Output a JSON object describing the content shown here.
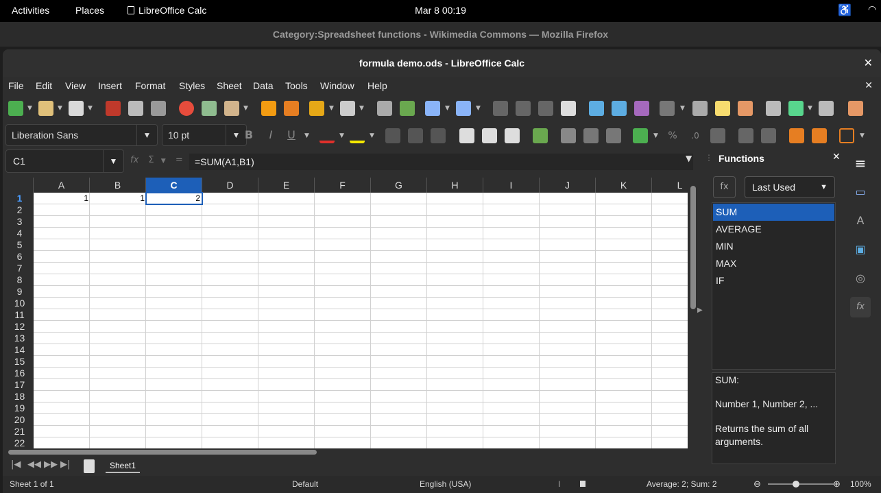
{
  "topbar": {
    "activities": "Activities",
    "places": "Places",
    "app_name": "LibreOffice Calc",
    "clock": "Mar 8  00:19"
  },
  "background_window": {
    "title": "Category:Spreadsheet functions - Wikimedia Commons — Mozilla Firefox"
  },
  "window": {
    "title": "formula demo.ods - LibreOffice Calc",
    "close": "✕"
  },
  "menu": {
    "items": [
      "File",
      "Edit",
      "View",
      "Insert",
      "Format",
      "Styles",
      "Sheet",
      "Data",
      "Tools",
      "Window",
      "Help"
    ],
    "doc_close": "✕"
  },
  "format_bar": {
    "font_name": "Liberation Sans",
    "font_size": "10 pt"
  },
  "formula_bar": {
    "name_box": "C1",
    "fx": "fx",
    "sigma": "Σ",
    "equals": "=",
    "formula": "=SUM(A1,B1)"
  },
  "grid": {
    "columns": [
      "A",
      "B",
      "C",
      "D",
      "E",
      "F",
      "G",
      "H",
      "I",
      "J",
      "K",
      "L"
    ],
    "selected_column": "C",
    "rows": [
      "1",
      "2",
      "3",
      "4",
      "5",
      "6",
      "7",
      "8",
      "9",
      "10",
      "11",
      "12",
      "13",
      "14",
      "15",
      "16",
      "17",
      "18",
      "19",
      "20",
      "21",
      "22"
    ],
    "cells": {
      "A1": "1",
      "B1": "1",
      "C1": "2"
    }
  },
  "sheet_tabs": {
    "tabs": [
      "Sheet1"
    ]
  },
  "status": {
    "sheet_pos": "Sheet 1 of 1",
    "page_style": "Default",
    "language": "English (USA)",
    "stats": "Average: 2; Sum: 2",
    "zoom": "100%"
  },
  "sidebar": {
    "title": "Functions",
    "close": "✕",
    "category": "Last Used",
    "functions": [
      "SUM",
      "AVERAGE",
      "MIN",
      "MAX",
      "IF"
    ],
    "selected": "SUM",
    "desc_name": "SUM:",
    "desc_args": "Number 1, Number 2, ...",
    "desc_text": "Returns the sum of all arguments."
  },
  "colors": {
    "selection": "#1d5fb8",
    "background": "#2e2e2e"
  }
}
